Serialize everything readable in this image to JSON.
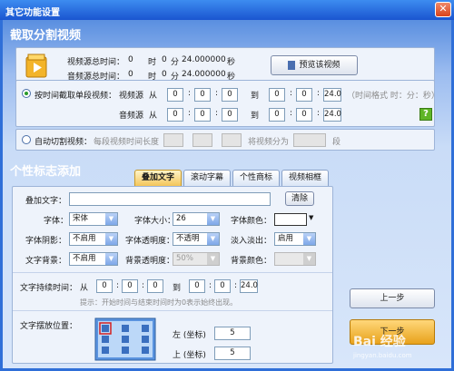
{
  "window": {
    "title": "其它功能设置",
    "close": "✕"
  },
  "section1": {
    "title": "截取分割视频",
    "video_total_label": "视频源总时间：",
    "audio_total_label": "音频源总时间：",
    "video_total": {
      "h": "0",
      "h_unit": "时",
      "m": "0",
      "m_unit": "分",
      "s": "24.000000",
      "s_unit": "秒"
    },
    "audio_total": {
      "h": "0",
      "h_unit": "时",
      "m": "0",
      "m_unit": "分",
      "s": "24.000000",
      "s_unit": "秒"
    },
    "preview_button": "预览该视频",
    "mode_time_label": "按时间截取单段视频：",
    "video_src": "视频源",
    "audio_src": "音频源",
    "from": "从",
    "to": "到",
    "video_from": [
      "0",
      "0",
      "0"
    ],
    "video_to": [
      "0",
      "0",
      "24.0"
    ],
    "audio_from": [
      "0",
      "0",
      "0"
    ],
    "audio_to": [
      "0",
      "0",
      "24.0"
    ],
    "time_format_hint": "（时间格式 时：分：秒）",
    "help_icon": "?",
    "mode_auto_label": "自动切割视频：",
    "segment_len_label": "每段视频时间长度",
    "split_into_label": "将视频分为",
    "segment_unit": "段"
  },
  "section2": {
    "title": "个性标志添加",
    "tabs": [
      "叠加文字",
      "滚动字幕",
      "个性商标",
      "视频相框"
    ],
    "overlay_text_label": "叠加文字：",
    "overlay_text_value": "",
    "clear_button": "清除",
    "font_label": "字体：",
    "font_value": "宋体",
    "font_size_label": "字体大小：",
    "font_size_value": "26",
    "font_color_label": "字体颜色：",
    "shadow_label": "字体阴影：",
    "shadow_value": "不启用",
    "transparency_label": "字体透明度：",
    "transparency_value": "不透明",
    "fade_label": "淡入淡出：",
    "fade_value": "启用",
    "bg_label": "文字背景：",
    "bg_value": "不启用",
    "bg_transparency_label": "背景透明度：",
    "bg_transparency_value": "50%",
    "bg_color_label": "背景颜色：",
    "duration_label": "文字持续时间：",
    "from": "从",
    "to": "到",
    "duration_from": [
      "0",
      "0",
      "0"
    ],
    "duration_to": [
      "0",
      "0",
      "24.0"
    ],
    "duration_hint": "提示：开始时间与结束时间时为0表示始终出现。",
    "position_label": "文字摆放位置：",
    "left_label": "左 (坐标)",
    "left_value": "5",
    "top_label": "上 (坐标)",
    "top_value": "5"
  },
  "buttons": {
    "prev": "上一步",
    "next": "下一步"
  },
  "watermark": {
    "text": "Bai 经验",
    "sub": "jingyan.baidu.com"
  }
}
